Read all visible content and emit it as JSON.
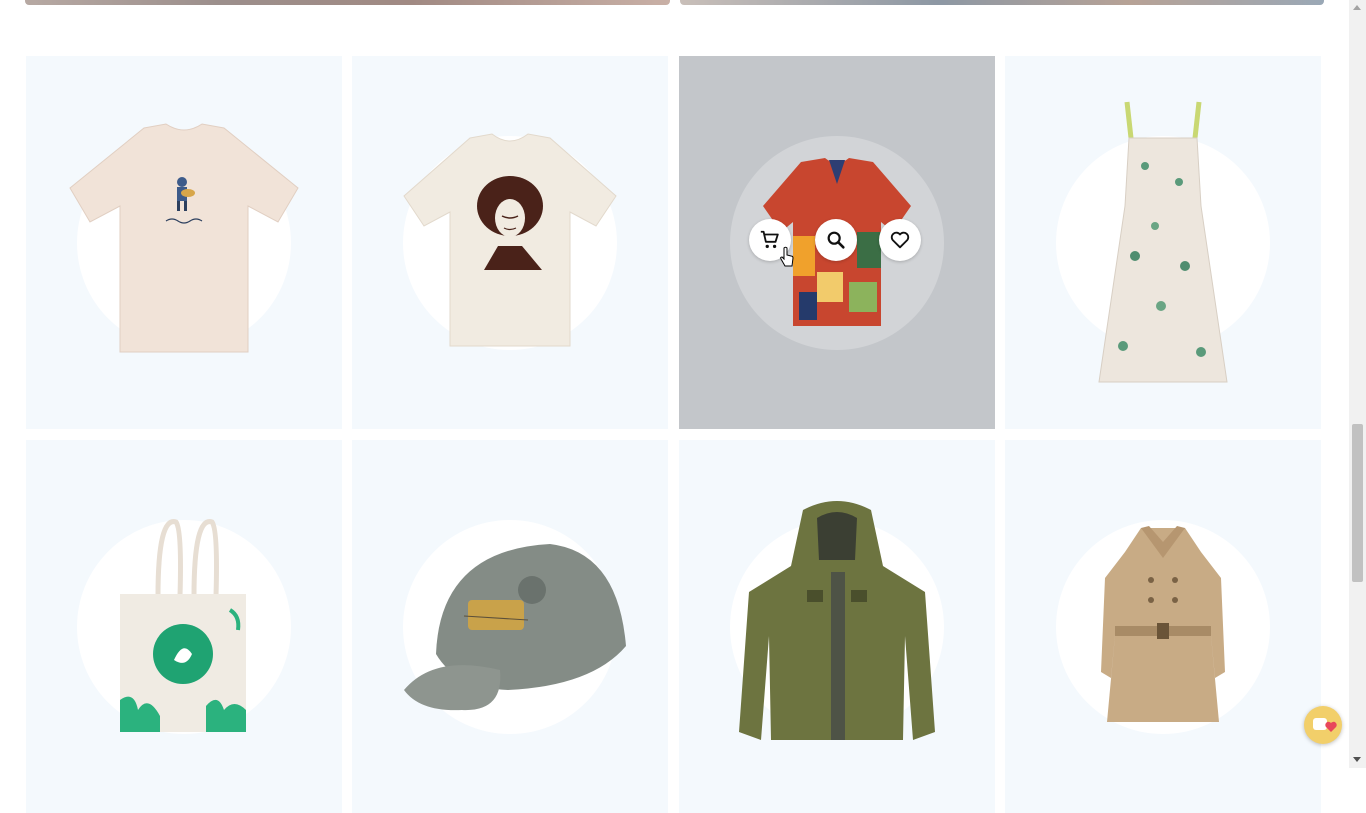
{
  "page": {
    "background": "#ffffff"
  },
  "products": [
    {
      "name": "life-is-good-guitar-tee",
      "icon": "cream-tshirt-image"
    },
    {
      "name": "portrait-graphic-tee",
      "icon": "cream-tshirt-portrait-image"
    },
    {
      "name": "geometric-print-shirt",
      "icon": "patterned-shirt-image",
      "hovered": true
    },
    {
      "name": "floral-sundress",
      "icon": "floral-dress-image"
    },
    {
      "name": "eco-tote-bag",
      "icon": "tote-bag-image"
    },
    {
      "name": "dog-patch-cap",
      "icon": "grey-cap-image"
    },
    {
      "name": "olive-hooded-jacket",
      "icon": "olive-jacket-image"
    },
    {
      "name": "beige-trench-coat",
      "icon": "trench-coat-image"
    }
  ],
  "hover_actions": [
    {
      "name": "add-to-cart",
      "icon": "cart-icon"
    },
    {
      "name": "quick-view",
      "icon": "search-icon"
    },
    {
      "name": "wishlist",
      "icon": "heart-icon"
    }
  ],
  "colors": {
    "card_bg": "#f4f9fd",
    "hover_overlay": "#c3c6ca",
    "chat_bubble": "#f2cf6a"
  }
}
